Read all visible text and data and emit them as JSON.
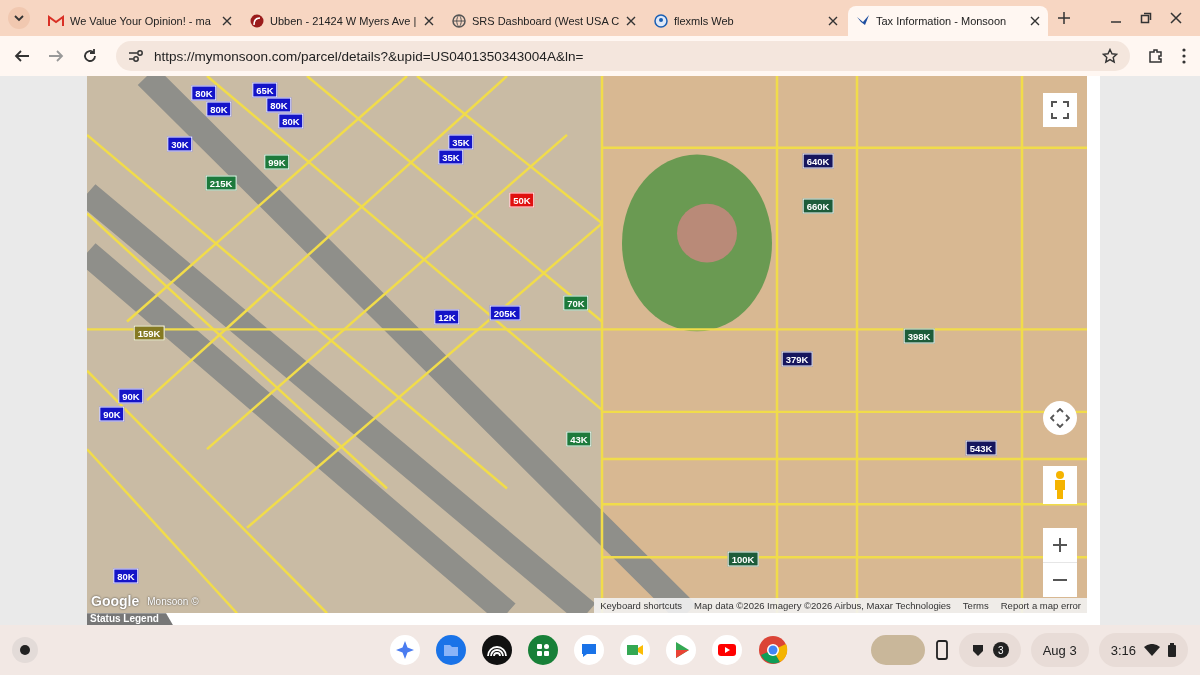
{
  "browser": {
    "tabs": [
      {
        "title": "We Value Your Opinion! - ma",
        "selected": false
      },
      {
        "title": "Ubben - 21424 W Myers Ave |",
        "selected": false
      },
      {
        "title": "SRS Dashboard (West USA C",
        "selected": false
      },
      {
        "title": "flexmls Web",
        "selected": false
      },
      {
        "title": "Tax Information - Monsoon",
        "selected": true
      }
    ],
    "url": "https://mymonsoon.com/parcel/details?&upid=US0401350343004A&ln="
  },
  "map": {
    "markers": [
      {
        "label": "80K",
        "color": "#1414c8"
      },
      {
        "label": "80K",
        "color": "#1414c8"
      },
      {
        "label": "65K",
        "color": "#1414c8"
      },
      {
        "label": "80K",
        "color": "#1414c8"
      },
      {
        "label": "80K",
        "color": "#1414c8"
      },
      {
        "label": "30K",
        "color": "#1414c8"
      },
      {
        "label": "35K",
        "color": "#1414c8"
      },
      {
        "label": "35K",
        "color": "#1414c8"
      },
      {
        "label": "99K",
        "color": "#1d7a3c"
      },
      {
        "label": "215K",
        "color": "#1d7a3c"
      },
      {
        "label": "50K",
        "color": "#e01010"
      },
      {
        "label": "70K",
        "color": "#1d7a3c"
      },
      {
        "label": "12K",
        "color": "#1414c8"
      },
      {
        "label": "205K",
        "color": "#1414c8"
      },
      {
        "label": "159K",
        "color": "#857a22"
      },
      {
        "label": "90K",
        "color": "#1414c8"
      },
      {
        "label": "90K",
        "color": "#1414c8"
      },
      {
        "label": "43K",
        "color": "#1d7a3c"
      },
      {
        "label": "80K",
        "color": "#1414c8"
      },
      {
        "label": "640K",
        "color": "#16165e"
      },
      {
        "label": "660K",
        "color": "#1d5c3a"
      },
      {
        "label": "379K",
        "color": "#16165e"
      },
      {
        "label": "398K",
        "color": "#1d5c3a"
      },
      {
        "label": "543K",
        "color": "#16165e"
      },
      {
        "label": "100K",
        "color": "#1d5c3a"
      }
    ],
    "logo": "Google",
    "brand": "Monsoon ©",
    "attribution": [
      "Keyboard shortcuts",
      "Map data ©2026 Imagery ©2026 Airbus, Maxar Technologies",
      "Terms",
      "Report a map error"
    ]
  },
  "legend": {
    "title": "Status Legend"
  },
  "shelf": {
    "notification_count": "3",
    "date": "Aug 3",
    "time": "3:16"
  }
}
